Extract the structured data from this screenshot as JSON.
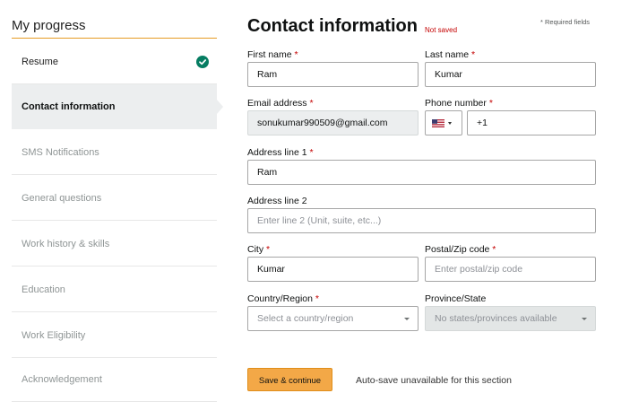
{
  "sidebar": {
    "title": "My progress",
    "items": [
      {
        "label": "Resume",
        "state": "done"
      },
      {
        "label": "Contact information",
        "state": "active"
      },
      {
        "label": "SMS Notifications",
        "state": "pending"
      },
      {
        "label": "General questions",
        "state": "pending"
      },
      {
        "label": "Work history & skills",
        "state": "pending"
      },
      {
        "label": "Education",
        "state": "pending"
      },
      {
        "label": "Work Eligibility",
        "state": "pending"
      },
      {
        "label": "Acknowledgement",
        "state": "pending"
      }
    ]
  },
  "header": {
    "title": "Contact information",
    "status": "Not saved",
    "required_note": "* Required fields"
  },
  "form": {
    "first_name": {
      "label": "First name",
      "required": "*",
      "value": "Ram"
    },
    "last_name": {
      "label": "Last name",
      "required": "*",
      "value": "Kumar"
    },
    "email": {
      "label": "Email address",
      "required": "*",
      "value": "sonukumar990509@gmail.com"
    },
    "phone": {
      "label": "Phone number",
      "required": "*",
      "country_icon": "us-flag-icon",
      "value": "+1"
    },
    "address1": {
      "label": "Address line 1",
      "required": "*",
      "value": "Ram"
    },
    "address2": {
      "label": "Address line 2",
      "value": "",
      "placeholder": "Enter line 2 (Unit, suite, etc...)"
    },
    "city": {
      "label": "City",
      "required": "*",
      "value": "Kumar"
    },
    "postal": {
      "label": "Postal/Zip code",
      "required": "*",
      "value": "",
      "placeholder": "Enter postal/zip code"
    },
    "country": {
      "label": "Country/Region",
      "required": "*",
      "selected": "Select a country/region"
    },
    "province": {
      "label": "Province/State",
      "selected": "No states/provinces available"
    }
  },
  "footer": {
    "save_label": "Save & continue",
    "autosave_note": "Auto-save unavailable for this section"
  },
  "colors": {
    "accent": "#e69c24",
    "button": "#f3a847",
    "required": "#c40000",
    "success": "#067d62"
  }
}
